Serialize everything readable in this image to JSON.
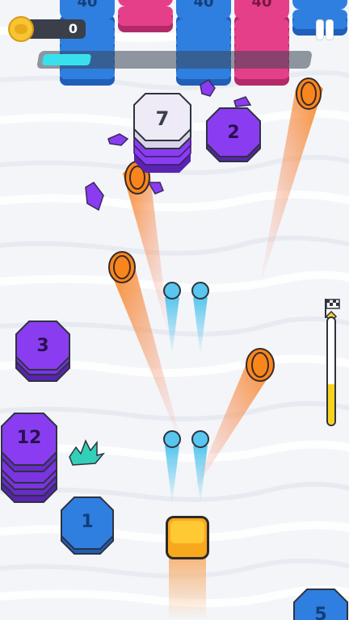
{
  "hud": {
    "coins": "0",
    "progress_fraction": 0.18,
    "pause_icon": "pause-icon",
    "coin_icon": "coin-icon"
  },
  "top_stacks": [
    {
      "label": "40",
      "color": "#2f7fe0"
    },
    {
      "label": "",
      "color": "#e63f8a"
    },
    {
      "label": "40",
      "color": "#2f7fe0"
    },
    {
      "label": "40",
      "color": "#e63f8a"
    },
    {
      "label": "",
      "color": "#2f7fe0"
    }
  ],
  "blocks": [
    {
      "id": "white-7",
      "label": "7",
      "color": "#eeeaf6"
    },
    {
      "id": "purple-2",
      "label": "2",
      "color": "#8a3df0"
    },
    {
      "id": "purple-3",
      "label": "3",
      "color": "#8a3df0"
    },
    {
      "id": "purple-12",
      "label": "12",
      "color": "#8a3df0"
    },
    {
      "id": "blue-1",
      "label": "1",
      "color": "#2f7fe0"
    },
    {
      "id": "blue-5",
      "label": "5",
      "color": "#2f7fe0"
    }
  ],
  "level_meter": {
    "fill_fraction": 0.38,
    "flag_icon": "checkered-flag-icon"
  },
  "colors": {
    "accent_cyan": "#38e0ee",
    "fireball": "#f88a1e",
    "bullet": "#59c6ee",
    "player": "#f8a81c"
  }
}
